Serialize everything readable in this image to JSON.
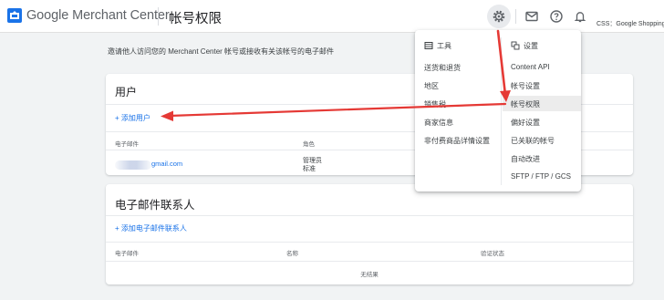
{
  "header": {
    "brand": "Google Merchant Center",
    "page_title": "帐号权限",
    "account_label": "CSS：Google Shopping",
    "icons": [
      "settings-gear-icon",
      "mail-icon",
      "help-icon",
      "bell-icon"
    ]
  },
  "intro_text": "邀请他人访问您的 Merchant Center 帐号或接收有关该帐号的电子邮件",
  "users": {
    "title": "用户",
    "add_label": "+ 添加用户",
    "columns": [
      "电子邮件",
      "角色"
    ],
    "rows": [
      {
        "email": "gmail.com",
        "role_line1": "管理员",
        "role_line2": "标准"
      }
    ]
  },
  "contacts": {
    "title": "电子邮件联系人",
    "add_label": "+ 添加电子邮件联系人",
    "columns": [
      "电子邮件",
      "名称",
      "验证状态"
    ],
    "empty_text": "无结果"
  },
  "settings_menu": {
    "tools_header": "工具",
    "tools": [
      "送货和退货",
      "地区",
      "销售税",
      "商家信息",
      "非付费商品详情设置"
    ],
    "settings_header": "设置",
    "settings": [
      "Content API",
      "帐号设置",
      "帐号权限",
      "偏好设置",
      "已关联的帐号",
      "自动改进",
      "SFTP / FTP / GCS"
    ],
    "active_item": "帐号权限"
  },
  "colors": {
    "link_blue": "#1a73e8",
    "annotation_red": "#e53935",
    "active_row": "#ececec"
  }
}
